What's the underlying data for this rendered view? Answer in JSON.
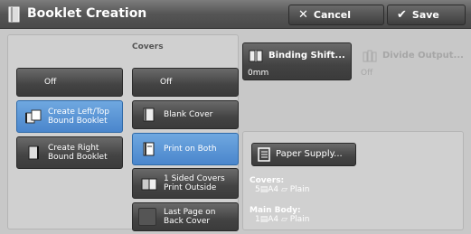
{
  "window": {
    "title": "Booklet Creation",
    "title_icon": "booklet-icon"
  },
  "toolbar": {
    "cancel_label": "Cancel",
    "save_label": "Save"
  },
  "booklet_type": {
    "off_label": "Off",
    "left_top_label": "Create Left/Top Bound Booklet",
    "right_label": "Create Right Bound Booklet",
    "selected": "left_top"
  },
  "covers": {
    "heading": "Covers",
    "off_label": "Off",
    "blank_label": "Blank Cover",
    "print_both_label": "Print on Both",
    "one_sided_label": "1 Sided Covers Print Outside",
    "last_page_label": "Last Page on Back Cover",
    "selected": "print_both",
    "last_page_checked": false
  },
  "binding_shift": {
    "label": "Binding Shift...",
    "value": "0mm"
  },
  "divide_output": {
    "label": "Divide Output...",
    "value": "Off",
    "enabled": false
  },
  "paper_supply": {
    "label": "Paper Supply...",
    "covers_label": "Covers:",
    "covers_value": "5▤A4 ▱ Plain",
    "main_label": "Main Body:",
    "main_value": "1▤A4 ▱ Plain"
  },
  "colors": {
    "selected": "#4a86cc",
    "button": "#434343",
    "title_bar": "#555555"
  }
}
